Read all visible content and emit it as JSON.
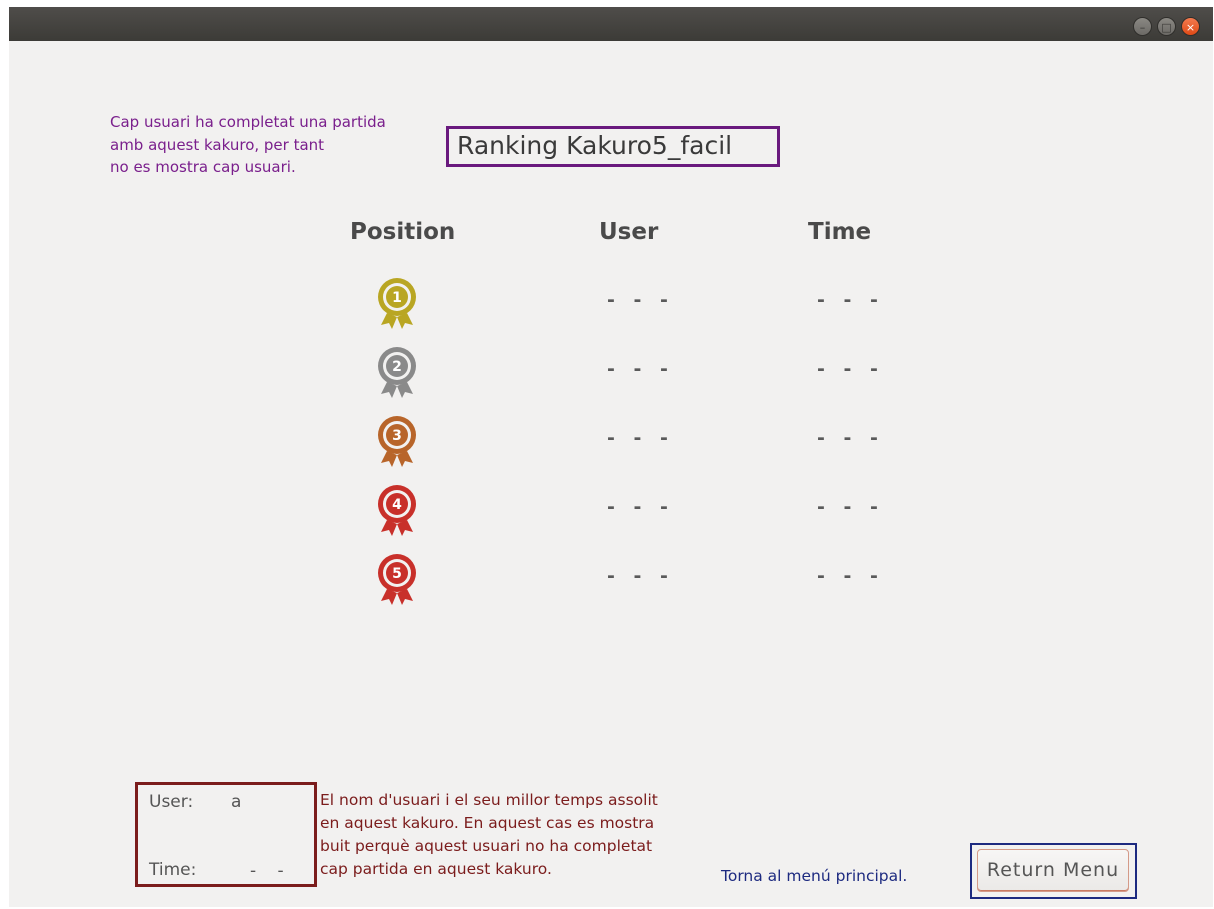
{
  "window": {
    "controls": [
      "minimize-icon",
      "maximize-icon",
      "close-icon"
    ]
  },
  "notes": {
    "purple": "Cap usuari ha completat una partida\namb aquest kakuro, per tant\nno es mostra cap usuari.",
    "red": "El nom d'usuari i el seu millor temps assolit\nen aquest kakuro. En aquest cas es mostra\nbuit perquè aquest usuari no ha completat\ncap partida en aquest kakuro.",
    "blue": "Torna al menú principal."
  },
  "ranking": {
    "title": "Ranking  Kakuro5_facil",
    "headers": {
      "position": "Position",
      "user": "User",
      "time": "Time"
    },
    "rows": [
      {
        "position": "1",
        "medal_color": "#b9a623",
        "user": "- - -",
        "time": "- - -"
      },
      {
        "position": "2",
        "medal_color": "#8a8a8a",
        "user": "- - -",
        "time": "- - -"
      },
      {
        "position": "3",
        "medal_color": "#b8652a",
        "user": "- - -",
        "time": "- - -"
      },
      {
        "position": "4",
        "medal_color": "#c8302a",
        "user": "- - -",
        "time": "- - -"
      },
      {
        "position": "5",
        "medal_color": "#c8302a",
        "user": "- - -",
        "time": "- - -"
      }
    ]
  },
  "current_user": {
    "user_label": "User:",
    "user_value": "a",
    "time_label": "Time:",
    "time_value": "- -"
  },
  "buttons": {
    "return_menu": "Return Menu"
  },
  "colors": {
    "accent_purple": "#6a1a7e",
    "accent_red": "#7b1c1c",
    "accent_blue": "#1d2a80"
  }
}
